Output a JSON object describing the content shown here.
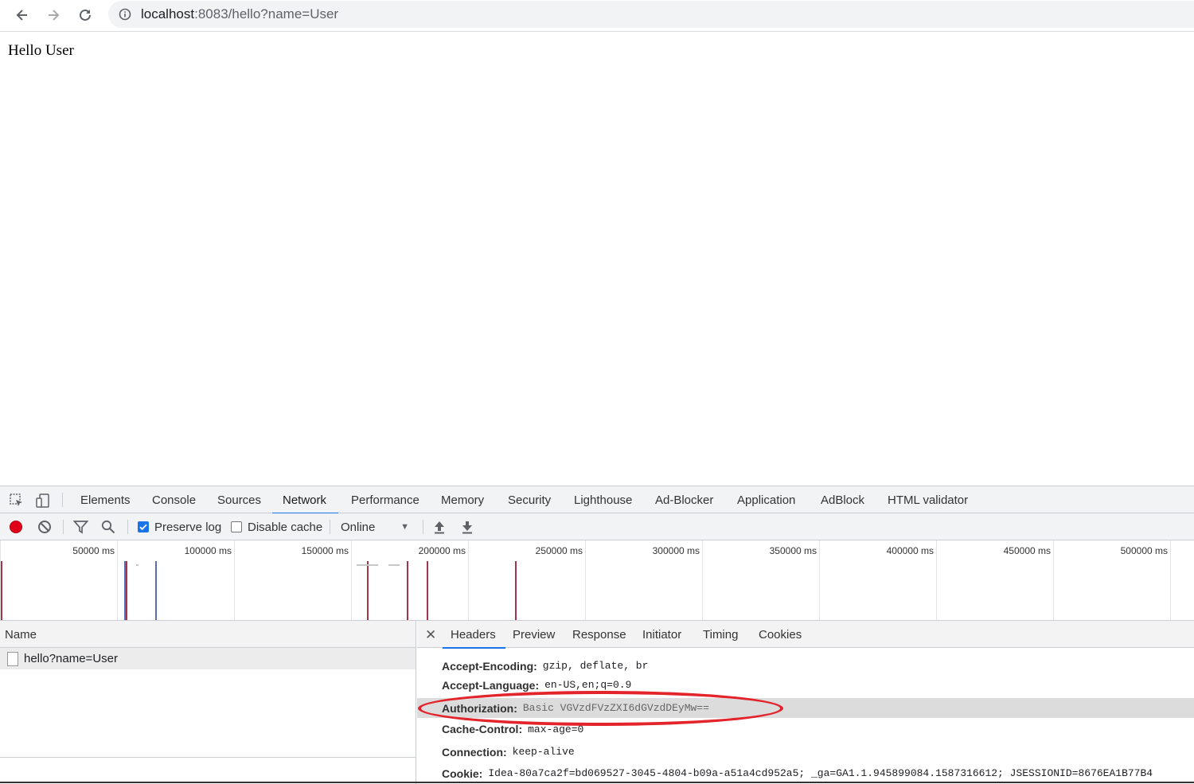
{
  "browser": {
    "url_host": "localhost",
    "url_rest": ":8083/hello?name=User",
    "icons": {
      "back": "arrow-left-icon",
      "forward": "arrow-right-icon",
      "reload": "reload-icon",
      "info": "info-icon"
    }
  },
  "page": {
    "body_text": "Hello User"
  },
  "devtools": {
    "tabs": [
      "Elements",
      "Console",
      "Sources",
      "Network",
      "Performance",
      "Memory",
      "Security",
      "Lighthouse",
      "Ad-Blocker",
      "Application",
      "AdBlock",
      "HTML validator"
    ],
    "active_tab": "Network",
    "toolbar": {
      "preserve_log": {
        "label": "Preserve log",
        "checked": true
      },
      "disable_cache": {
        "label": "Disable cache",
        "checked": false
      },
      "throttling": "Online"
    },
    "overview_labels": [
      "50000 ms",
      "100000 ms",
      "150000 ms",
      "200000 ms",
      "250000 ms",
      "300000 ms",
      "350000 ms",
      "400000 ms",
      "450000 ms",
      "500000 ms"
    ],
    "request_list": {
      "column_name": "Name",
      "rows": [
        "hello?name=User"
      ]
    },
    "details": {
      "tabs": [
        "Headers",
        "Preview",
        "Response",
        "Initiator",
        "Timing",
        "Cookies"
      ],
      "active_tab": "Headers",
      "headers": [
        {
          "key": "Accept-Encoding:",
          "value": "gzip, deflate, br"
        },
        {
          "key": "Accept-Language:",
          "value": "en-US,en;q=0.9"
        },
        {
          "key": "Authorization:",
          "value": "Basic VGVzdFVzZXI6dGVzdDEyMw==",
          "highlighted": true
        },
        {
          "key": "Cache-Control:",
          "value": "max-age=0"
        },
        {
          "key": "Connection:",
          "value": "keep-alive"
        },
        {
          "key": "Cookie:",
          "value": "Idea-80a7ca2f=bd069527-3045-4804-b09a-a51a4cd952a5; _ga=GA1.1.945899084.1587316612; JSESSIONID=8676EA1B77B4"
        }
      ]
    },
    "annotation_color": "#e3242b",
    "accent_color": "#1a73e8"
  }
}
